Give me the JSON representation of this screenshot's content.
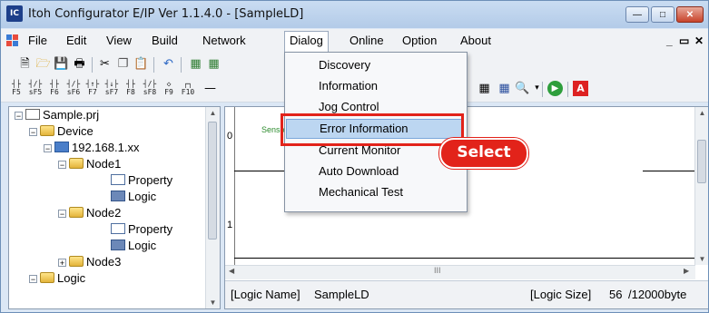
{
  "window": {
    "title": "Itoh Configurator E/IP Ver 1.1.4.0 - [SampleLD]",
    "app_icon_text": "IC"
  },
  "menubar": {
    "items": [
      "File",
      "Edit",
      "View",
      "Build",
      "Network",
      "Dialog",
      "Online",
      "Option",
      "About"
    ],
    "active": "Dialog"
  },
  "toolbar2": {
    "fkeys": [
      {
        "glyph": "┤├",
        "label": "F5"
      },
      {
        "glyph": "┤/├",
        "label": "sF5"
      },
      {
        "glyph": "┤├",
        "label": "F6"
      },
      {
        "glyph": "┤/├",
        "label": "sF6"
      },
      {
        "glyph": "┤↑├",
        "label": "F7"
      },
      {
        "glyph": "┤↓├",
        "label": "sF7"
      },
      {
        "glyph": "┤├",
        "label": "F8"
      },
      {
        "glyph": "┤/├",
        "label": "sF8"
      },
      {
        "glyph": "◇",
        "label": "F9"
      },
      {
        "glyph": "┌┐",
        "label": "F10"
      }
    ]
  },
  "dialog_menu": {
    "items": [
      "Discovery",
      "Information",
      "Jog Control",
      "Error Information",
      "Current Monitor",
      "Auto Download",
      "Mechanical Test"
    ],
    "highlighted": "Error Information"
  },
  "annotation": {
    "callout_text": "Select",
    "color": "#e2231a"
  },
  "tree": {
    "nodes": [
      {
        "label": "Sample.prj",
        "icon": "project-icon"
      },
      {
        "label": "Device",
        "icon": "folder-icon"
      },
      {
        "label": "192.168.1.xx",
        "icon": "network-icon"
      },
      {
        "label": "Node1",
        "icon": "folder-icon"
      },
      {
        "label": "Property",
        "icon": "property-icon"
      },
      {
        "label": "Logic",
        "icon": "logic-icon"
      },
      {
        "label": "Node2",
        "icon": "folder-icon"
      },
      {
        "label": "Property",
        "icon": "property-icon"
      },
      {
        "label": "Logic",
        "icon": "logic-icon"
      },
      {
        "label": "Node3",
        "icon": "folder-icon"
      },
      {
        "label": "Logic",
        "icon": "folder-icon"
      }
    ]
  },
  "editor": {
    "rung_numbers": [
      "0",
      "1"
    ],
    "contact_label": "Senso",
    "status": {
      "logic_name_label": "[Logic Name]",
      "logic_name": "SampleLD",
      "logic_size_label": "[Logic Size]",
      "logic_size": "56",
      "logic_size_max": "/12000byte"
    },
    "hscroll_mark": "III"
  },
  "colors": {
    "accent": "#e2231a",
    "highlight": "#bcd6f1",
    "window_frame": "#dbe7f5"
  }
}
